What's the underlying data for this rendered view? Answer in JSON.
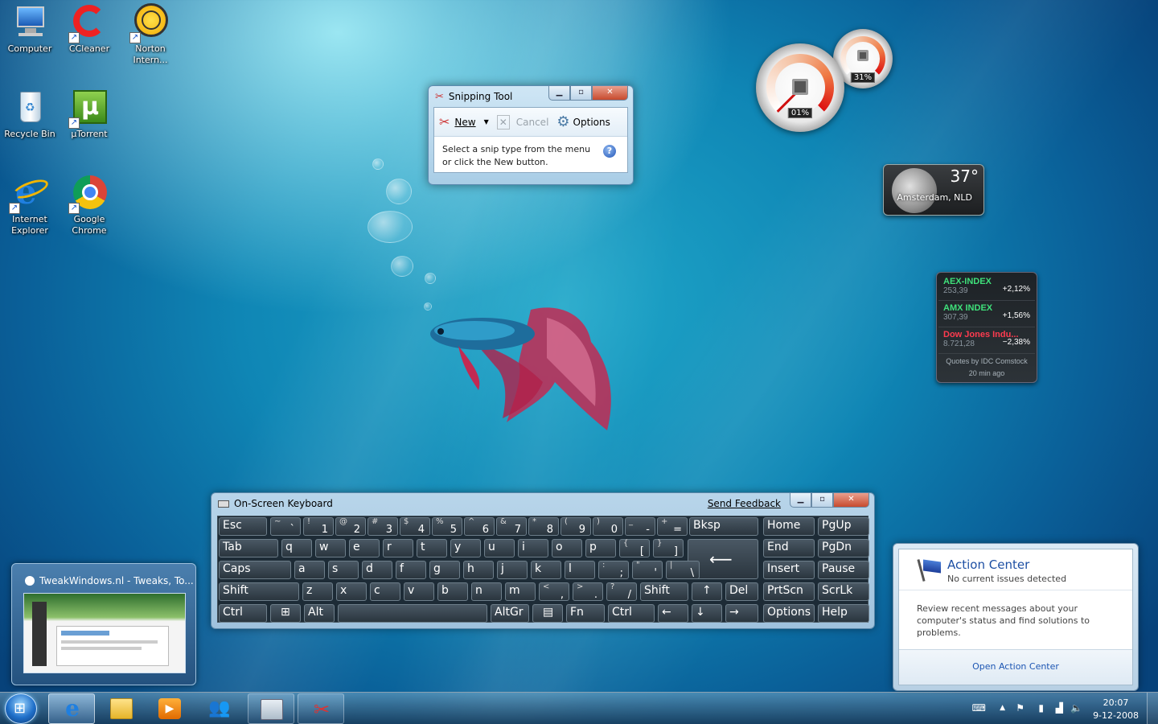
{
  "desktop_icons": [
    {
      "label": "Computer",
      "icon": "computer-icon"
    },
    {
      "label": "CCleaner",
      "icon": "ccleaner-icon"
    },
    {
      "label": "Norton Intern...",
      "icon": "norton-icon"
    },
    {
      "label": "Recycle Bin",
      "icon": "recycle-bin-icon"
    },
    {
      "label": "µTorrent",
      "icon": "utorrent-icon"
    },
    {
      "label": "Internet Explorer",
      "icon": "internet-explorer-icon"
    },
    {
      "label": "Google Chrome",
      "icon": "google-chrome-icon"
    }
  ],
  "snipping_tool": {
    "title": "Snipping Tool",
    "new_label": "New",
    "cancel_label": "Cancel",
    "options_label": "Options",
    "message_line1": "Select a snip type from the menu",
    "message_line2": "or click the New button."
  },
  "gauges": {
    "cpu_value": "01%",
    "memory_value": "31%",
    "cpu_level": 0.01,
    "memory_level": 0.31
  },
  "weather": {
    "temperature": "37°",
    "location": "Amsterdam, NLD"
  },
  "stocks": {
    "items": [
      {
        "name": "AEX-INDEX",
        "price": "253,39",
        "change": "+2,12%",
        "color": "#3fe07a"
      },
      {
        "name": "AMX INDEX",
        "price": "307,39",
        "change": "+1,56%",
        "color": "#3fe07a"
      },
      {
        "name": "Dow Jones Indu...",
        "price": "8.721,28",
        "change": "−2,38%",
        "color": "#ff3b4f"
      }
    ],
    "source": "Quotes by IDC Comstock",
    "updated": "20 min ago"
  },
  "osk": {
    "title": "On-Screen Keyboard",
    "feedback": "Send Feedback",
    "keys": {
      "esc": "Esc",
      "tilde_sup": "~",
      "tilde": "`",
      "n1_sup": "!",
      "n1": "1",
      "n2_sup": "@",
      "n2": "2",
      "n3_sup": "#",
      "n3": "3",
      "n4_sup": "$",
      "n4": "4",
      "n5_sup": "%",
      "n5": "5",
      "n6_sup": "^",
      "n6": "6",
      "n7_sup": "&",
      "n7": "7",
      "n8_sup": "*",
      "n8": "8",
      "n9_sup": "(",
      "n9": "9",
      "n0_sup": ")",
      "n0": "0",
      "minus_sup": "_",
      "minus": "-",
      "plus_sup": "+",
      "plus": "=",
      "bksp": "Bksp",
      "home": "Home",
      "pgup": "PgUp",
      "tab": "Tab",
      "q": "q",
      "w": "w",
      "e": "e",
      "r": "r",
      "t": "t",
      "y": "y",
      "u": "u",
      "i": "i",
      "o": "o",
      "p": "p",
      "lbr_sup": "{",
      "lbr": "[",
      "rbr_sup": "}",
      "rbr": "]",
      "enter": "⟵",
      "end": "End",
      "pgdn": "PgDn",
      "caps": "Caps",
      "a": "a",
      "s": "s",
      "d": "d",
      "f": "f",
      "g": "g",
      "h": "h",
      "j": "j",
      "k": "k",
      "l": "l",
      "semi_sup": ":",
      "semi": ";",
      "quote_sup": "\"",
      "quote": "'",
      "bsl_sup": "|",
      "bsl": "\\",
      "insert": "Insert",
      "pause": "Pause",
      "shift": "Shift",
      "z": "z",
      "x": "x",
      "c": "c",
      "v": "v",
      "b": "b",
      "n": "n",
      "m": "m",
      "comma_sup": "<",
      "comma": ",",
      "dot_sup": ">",
      "dot": ".",
      "slash_sup": "?",
      "slash": "/",
      "shift_r": "Shift",
      "up": "↑",
      "del": "Del",
      "prtscn": "PrtScn",
      "scrlk": "ScrLk",
      "ctrl": "Ctrl",
      "alt": "Alt",
      "altgr": "AltGr",
      "fn": "Fn",
      "ctrl_r": "Ctrl",
      "left": "←",
      "down": "↓",
      "right": "→",
      "options": "Options",
      "help": "Help"
    }
  },
  "thumbnail": {
    "title": "TweakWindows.nl - Tweaks, To..."
  },
  "action_center": {
    "title": "Action Center",
    "status": "No current issues detected",
    "message": "Review recent messages about your computer's status and find solutions to problems.",
    "link": "Open Action Center"
  },
  "taskbar": {
    "time": "20:07",
    "date": "9-12-2008"
  }
}
